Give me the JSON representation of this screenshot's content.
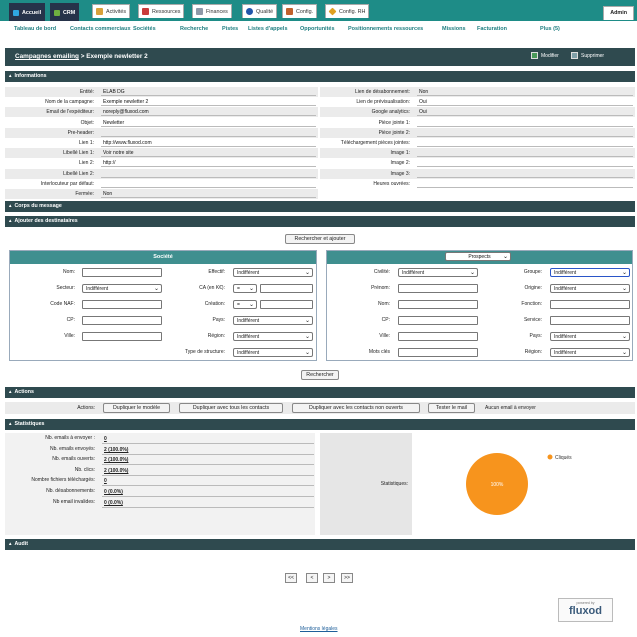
{
  "tabs": [
    {
      "label": "Accueil",
      "icon": "home-icon",
      "color": "#2fa7e0"
    },
    {
      "label": "CRM",
      "icon": "crm-icon",
      "color": "#6fb040"
    },
    {
      "label": "Activités",
      "icon": "calendar-icon",
      "color": "#d9a13a"
    },
    {
      "label": "Ressources",
      "icon": "resources-icon",
      "color": "#c83b3b"
    },
    {
      "label": "Finances",
      "icon": "finances-icon",
      "color": "#8f99a8"
    },
    {
      "label": "Qualité",
      "icon": "quality-icon",
      "color": "#2255aa"
    },
    {
      "label": "Config.",
      "icon": "tools-icon",
      "color": "#c2612c"
    },
    {
      "label": "Config. RH",
      "icon": "hr-config-icon",
      "color": "#e0a020"
    }
  ],
  "admin_label": "Admin",
  "subnav": [
    "Tableau de bord",
    "Contacts commerciaux",
    "Sociétés",
    "Recherche",
    "Pistes",
    "Listes d'appels",
    "Opportunités",
    "Positionnements ressources",
    "Missions",
    "Facturation",
    "Plus (5)"
  ],
  "title": {
    "link": "Campagnes emailing",
    "rest": " > Exemple newletter 2"
  },
  "actions_top": {
    "edit": "Modifier",
    "delete": "Supprimer"
  },
  "sections": {
    "informations": "Informations",
    "corps": "Corps du message",
    "destinataires": "Ajouter des destinataires",
    "actions": "Actions",
    "statistiques": "Statistiques",
    "audit": "Audit"
  },
  "info_left": [
    {
      "label": "Entité:",
      "value": "ELAB DG"
    },
    {
      "label": "Nom de la campagne:",
      "value": "Exemple newletter 2"
    },
    {
      "label": "Email de l'expéditeur:",
      "value": "noreply@fluxod.com"
    },
    {
      "label": "Objet:",
      "value": "Newletter"
    },
    {
      "label": "Pre-header:",
      "value": ""
    },
    {
      "label": "Lien 1:",
      "value": "http://www.fluxod.com"
    },
    {
      "label": "Libellé Lien 1:",
      "value": "Voir notre site"
    },
    {
      "label": "Lien 2:",
      "value": "http://"
    },
    {
      "label": "Libellé Lien 2:",
      "value": ""
    },
    {
      "label": "Interlocuteur par défaut:",
      "value": ""
    },
    {
      "label": "Fermée:",
      "value": "Non"
    }
  ],
  "info_right": [
    {
      "label": "Lien de désabonnement:",
      "value": "Non"
    },
    {
      "label": "Lien de prévisualisation:",
      "value": "Oui"
    },
    {
      "label": "Google analytics:",
      "value": "Oui"
    },
    {
      "label": "Pièce jointe 1:",
      "value": ""
    },
    {
      "label": "Pièce jointe 2:",
      "value": ""
    },
    {
      "label": "Téléchargement pièces jointes:",
      "value": ""
    },
    {
      "label": "Image 1:",
      "value": ""
    },
    {
      "label": "Image 2:",
      "value": ""
    },
    {
      "label": "Image 3:",
      "value": ""
    },
    {
      "label": "Heures ouvrées:",
      "value": ""
    }
  ],
  "search_add_button": "Rechercher et ajouter",
  "societe_panel": {
    "title": "Société",
    "nom": "Nom:",
    "effectif": "Effectif:",
    "effectif_value": "Indifférent",
    "secteur": "Secteur:",
    "secteur_value": "Indifférent",
    "ca": "CA (en K€):",
    "ca_op": "=",
    "code_naf": "Code NAF:",
    "creation": "Création:",
    "creation_op": "=",
    "cp": "CP:",
    "pays": "Pays:",
    "pays_value": "Indifférent",
    "ville": "Ville:",
    "region": "Région:",
    "region_value": "Indifférent",
    "type_structure": "Type de structure:",
    "type_structure_value": "Indifférent"
  },
  "prospects_panel": {
    "select": "Prospects",
    "civilite": "Civilité:",
    "civilite_value": "Indifférent",
    "groupe": "Groupe:",
    "groupe_value": "Indifférent",
    "prenom": "Prénom:",
    "origine": "Origine:",
    "origine_value": "Indifférent",
    "nom": "Nom:",
    "fonction": "Fonction:",
    "cp": "CP:",
    "service": "Service:",
    "ville": "Ville:",
    "pays": "Pays:",
    "pays_value": "Indifférent",
    "mots_cles": "Mots clés",
    "region": "Région:",
    "region_value": "Indifférent"
  },
  "search_button": "Rechercher",
  "actions": {
    "label": "Actions:",
    "buttons": [
      "Dupliquer le modèle",
      "Dupliquer avec tous les contacts",
      "Dupliquer avec les contacts non ouverts",
      "Tester le mail"
    ],
    "note": "Aucun email à envoyer"
  },
  "stats": [
    {
      "label": "Nb. emails à envoyer :",
      "value": "0"
    },
    {
      "label": "Nb. emails envoyés:",
      "value": "2 (100.0%)"
    },
    {
      "label": "Nb. emails ouverts:",
      "value": "2 (100.0%)"
    },
    {
      "label": "Nb. clics:",
      "value": "2 (100.0%)"
    },
    {
      "label": "Nombre fichiers téléchargés:",
      "value": "0"
    },
    {
      "label": "Nb. désabonnements:",
      "value": "0 (0.0%)"
    },
    {
      "label": "Nb email invalides:",
      "value": "0 (0.0%)"
    }
  ],
  "stats_label": "Statistiques:",
  "chart_data": {
    "type": "pie",
    "title": "",
    "slices": [
      {
        "label": "Cliqués",
        "value": 100,
        "color": "#f7941d"
      }
    ],
    "data_label": "100%",
    "legend": "top-right"
  },
  "pagination": [
    "<<",
    "<",
    ">",
    ">>"
  ],
  "logo": {
    "small": "powered by",
    "brand": "fluxod"
  },
  "footer_link": "Mentions légales"
}
